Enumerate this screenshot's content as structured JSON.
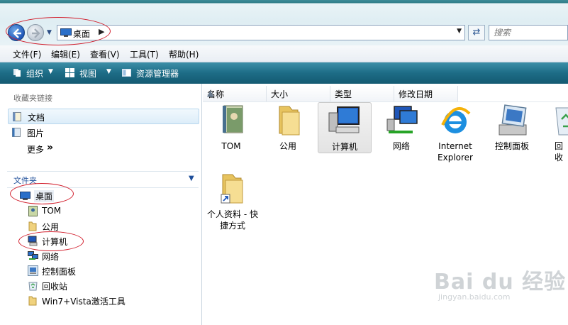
{
  "address": {
    "location": "桌面",
    "search_placeholder": "搜索"
  },
  "menu": [
    "文件(F)",
    "编辑(E)",
    "查看(V)",
    "工具(T)",
    "帮助(H)"
  ],
  "commands": {
    "organize": "组织",
    "views": "视图",
    "explorer": "资源管理器"
  },
  "nav": {
    "favorites_header": "收藏夹链接",
    "favorites": [
      {
        "label": "文档",
        "icon": "documents-icon"
      },
      {
        "label": "图片",
        "icon": "pictures-icon"
      },
      {
        "label": "更多",
        "icon": "double-chevron-icon"
      }
    ],
    "more_glyph": "»",
    "folders_header": "文件夹",
    "tree": [
      {
        "label": "桌面",
        "icon": "desktop-icon"
      },
      {
        "label": "TOM",
        "icon": "user-folder-icon"
      },
      {
        "label": "公用",
        "icon": "folder-icon"
      },
      {
        "label": "计算机",
        "icon": "computer-icon"
      },
      {
        "label": "网络",
        "icon": "network-icon"
      },
      {
        "label": "控制面板",
        "icon": "control-panel-icon"
      },
      {
        "label": "回收站",
        "icon": "recycle-bin-icon"
      },
      {
        "label": "Win7+Vista激活工具",
        "icon": "folder-icon"
      }
    ]
  },
  "columns": [
    "名称",
    "大小",
    "类型",
    "修改日期"
  ],
  "items": [
    {
      "label": "TOM",
      "icon": "user-folder-icon"
    },
    {
      "label": "公用",
      "icon": "folder-icon"
    },
    {
      "label": "计算机",
      "icon": "computer-icon"
    },
    {
      "label": "网络",
      "icon": "network-icon"
    },
    {
      "label": "Internet Explorer",
      "icon": "ie-icon"
    },
    {
      "label": "控制面板",
      "icon": "control-panel-icon"
    },
    {
      "label": "回收",
      "icon": "recycle-bin-icon"
    },
    {
      "label": "个人资料 - 快捷方式",
      "icon": "shortcut-folder-icon"
    }
  ],
  "watermark": {
    "brand": "Bai du 经验",
    "url": "jingyan.baidu.com"
  },
  "colors": {
    "command_bar": "#1d6c86",
    "annotation": "#d2202e",
    "nav_header": "#1f4f9a"
  }
}
